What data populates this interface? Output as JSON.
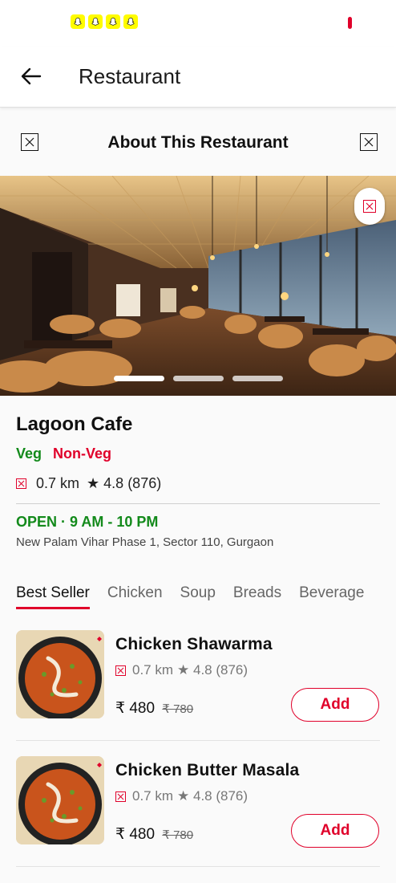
{
  "status_bar": {
    "notification_icons": [
      "snapchat-icon",
      "snapchat-icon",
      "snapchat-icon",
      "snapchat-icon"
    ],
    "record_color": "#e0002a"
  },
  "app_bar": {
    "title": "Restaurant"
  },
  "section": {
    "title": "About This Restaurant"
  },
  "carousel": {
    "count": 3,
    "active": 0
  },
  "restaurant": {
    "name": "Lagoon Cafe",
    "veg_label": "Veg",
    "nonveg_label": "Non-Veg",
    "distance": "0.7 km",
    "rating": "★ 4.8 (876)",
    "hours": "OPEN · 9 AM - 10 PM",
    "address": "New Palam Vihar Phase 1, Sector 110, Gurgaon"
  },
  "tabs": [
    {
      "label": "Best Seller",
      "active": true
    },
    {
      "label": "Chicken"
    },
    {
      "label": "Soup"
    },
    {
      "label": "Breads"
    },
    {
      "label": "Beverage"
    }
  ],
  "items": [
    {
      "name": "Chicken Shawarma",
      "distance": "0.7 km",
      "rating": "★ 4.8 (876)",
      "price": "₹ 480",
      "mrp": "₹ 780",
      "add_label": "Add"
    },
    {
      "name": "Chicken Butter Masala",
      "distance": "0.7 km",
      "rating": "★ 4.8 (876)",
      "price": "₹ 480",
      "mrp": "₹ 780",
      "add_label": "Add"
    }
  ],
  "colors": {
    "accent": "#e0002a",
    "veg": "#138a1b",
    "open": "#138a1b"
  }
}
